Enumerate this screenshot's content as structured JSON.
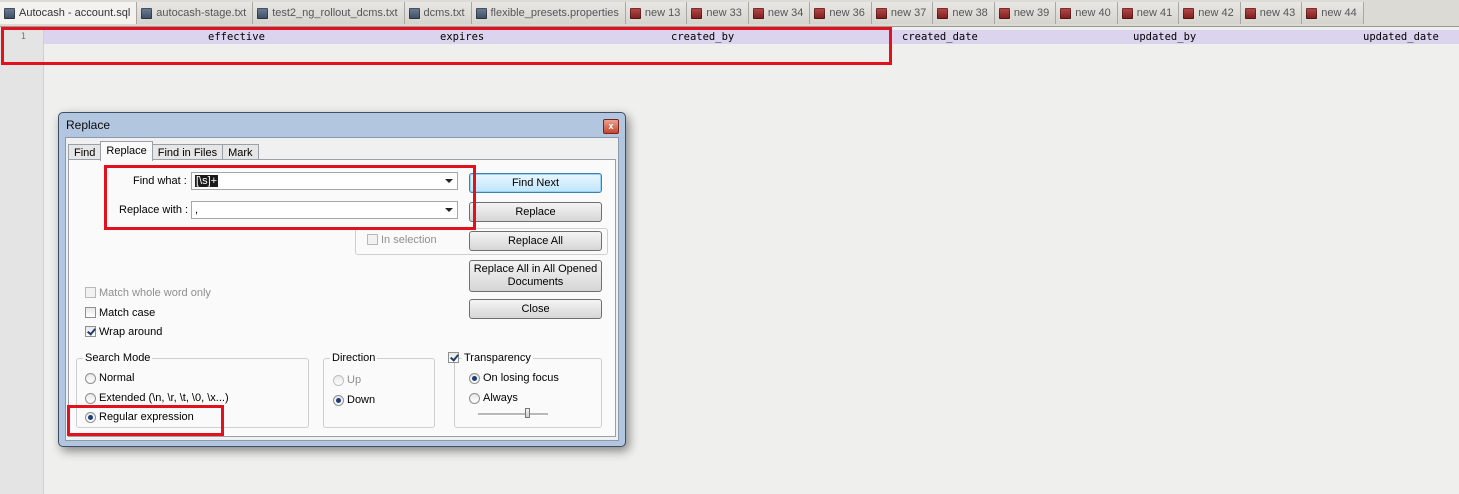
{
  "tabs": [
    {
      "label": "Autocash - account.sql",
      "icon": "blue"
    },
    {
      "label": "autocash-stage.txt",
      "icon": "blue"
    },
    {
      "label": "test2_ng_rollout_dcms.txt",
      "icon": "blue"
    },
    {
      "label": "dcms.txt",
      "icon": "blue"
    },
    {
      "label": "flexible_presets.properties",
      "icon": "blue"
    },
    {
      "label": "new  13",
      "icon": "red"
    },
    {
      "label": "new  33",
      "icon": "red"
    },
    {
      "label": "new  34",
      "icon": "red"
    },
    {
      "label": "new  36",
      "icon": "red"
    },
    {
      "label": "new  37",
      "icon": "red"
    },
    {
      "label": "new  38",
      "icon": "red"
    },
    {
      "label": "new  39",
      "icon": "red"
    },
    {
      "label": "new  40",
      "icon": "red"
    },
    {
      "label": "new  41",
      "icon": "red"
    },
    {
      "label": "new  42",
      "icon": "red"
    },
    {
      "label": "new  43",
      "icon": "red"
    },
    {
      "label": "new  44",
      "icon": "red"
    }
  ],
  "editor": {
    "line_number": "1",
    "columns": [
      "effective",
      "expires",
      "created_by",
      "created_date",
      "updated_by",
      "updated_date"
    ]
  },
  "dialog": {
    "title": "Replace",
    "close_glyph": "x",
    "tabs": [
      "Find",
      "Replace",
      "Find in Files",
      "Mark"
    ],
    "find_label": "Find what :",
    "find_value": "[\\s]+",
    "replace_label": "Replace with :",
    "replace_value": ",",
    "in_selection": "In selection",
    "buttons": {
      "find_next": "Find Next",
      "replace": "Replace",
      "replace_all": "Replace All",
      "replace_all_opened_1": "Replace All in All Opened",
      "replace_all_opened_2": "Documents",
      "close": "Close"
    },
    "options": {
      "match_whole_word": "Match whole word only",
      "match_case": "Match case",
      "wrap_around": "Wrap around"
    },
    "search_mode": {
      "title": "Search Mode",
      "normal": "Normal",
      "extended": "Extended (\\n, \\r, \\t, \\0, \\x...)",
      "regex": "Regular expression"
    },
    "direction": {
      "title": "Direction",
      "up": "Up",
      "down": "Down"
    },
    "transparency": {
      "title": "Transparency",
      "on_losing_focus": "On losing focus",
      "always": "Always"
    }
  },
  "colors": {
    "annotation": "#e3101d",
    "current_line": "#dcd3ee"
  }
}
